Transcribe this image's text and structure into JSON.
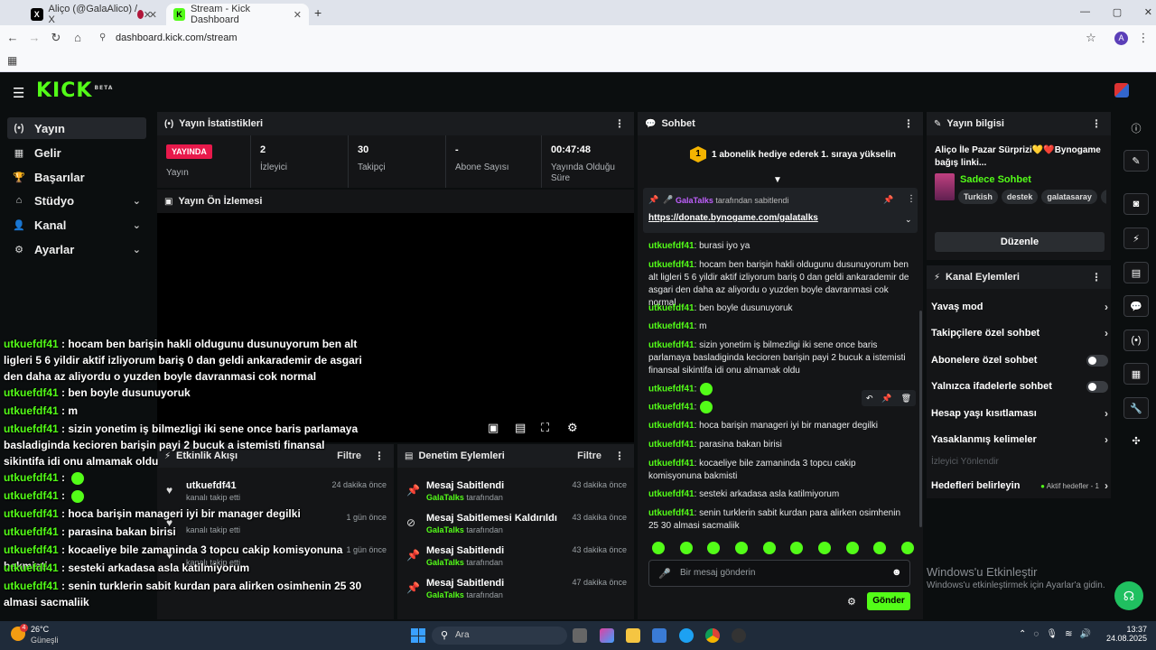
{
  "browser": {
    "tabs": [
      {
        "title": "Aliço (@GalaAlico) / X",
        "icon": "X"
      },
      {
        "title": "",
        "icon": "record"
      },
      {
        "title": "Stream - Kick Dashboard",
        "icon": "K"
      }
    ],
    "new_tab": "+",
    "url": "dashboard.kick.com/stream",
    "profile_initial": "A",
    "window_controls": [
      "—",
      "▢",
      "✕"
    ]
  },
  "kick": {
    "logo": "KICK",
    "logo_badge": "BETA"
  },
  "sidebar": {
    "items": [
      {
        "label": "Yayın",
        "icon": "(•)",
        "chevron": ""
      },
      {
        "label": "Gelir",
        "icon": "▦",
        "chevron": ""
      },
      {
        "label": "Başarılar",
        "icon": "🏆",
        "chevron": ""
      },
      {
        "label": "Stüdyo",
        "icon": "⌂",
        "chevron": "⌄"
      },
      {
        "label": "Kanal",
        "icon": "👤",
        "chevron": "⌄"
      },
      {
        "label": "Ayarlar",
        "icon": "⚙",
        "chevron": "⌄"
      }
    ]
  },
  "stats_panel": {
    "title": "Yayın İstatistikleri",
    "live_badge": "YAYINDA",
    "live_label": "Yayın",
    "viewers_value": "2",
    "viewers_label": "İzleyici",
    "followers_value": "30",
    "followers_label": "Takipçi",
    "subs_value": "-",
    "subs_label": "Abone Sayısı",
    "duration_value": "00:47:48",
    "duration_label": "Yayında Olduğu Süre"
  },
  "preview_panel": {
    "title": "Yayın Ön İzlemesi"
  },
  "overlay_chat": [
    {
      "user": "utkuefdf41",
      "text": " : hocam ben barişin hakli oldugunu dusunuyorum ben alt ligleri 5 6 yildir aktif izliyorum bariş 0 dan geldi ankarademir de asgari den daha az aliyordu o yuzden boyle davranmasi cok normal"
    },
    {
      "user": "utkuefdf41",
      "text": " : ben boyle dusunuyoruk"
    },
    {
      "user": "utkuefdf41",
      "text": " : m"
    },
    {
      "user": "utkuefdf41",
      "text": " : sizin yonetim iş bilmezligi iki sene once baris parlamaya basladiginda kecioren barişin payi 2 bucuk a istemisti finansal sikintifa idi onu almamak oldu"
    },
    {
      "user": "utkuefdf41",
      "text": " : "
    },
    {
      "user": "utkuefdf41",
      "text": " : "
    },
    {
      "user": "utkuefdf41",
      "text": " : hoca barişin manageri iyi bir manager degilki"
    },
    {
      "user": "utkuefdf41",
      "text": " : parasina bakan birisi"
    },
    {
      "user": "utkuefdf41",
      "text": " : kocaeliye bile zamaninda 3 topcu cakip komisyonuna bakmisti"
    },
    {
      "user": "utkuefdf41",
      "text": " : sesteki arkadasa asla katilmiyorum"
    },
    {
      "user": "utkuefdf41",
      "text": " : senin turklerin sabit kurdan para alirken osimhenin 25 30 almasi sacmaliik"
    }
  ],
  "activity_panel": {
    "title": "Etkinlik Akışı",
    "filter": "Filtre",
    "rows": [
      {
        "title": "utkuefdf41",
        "sub": "kanalı takip etti",
        "time": "24 dakika önce"
      },
      {
        "title": "",
        "sub": "kanalı takip etti",
        "time": "1 gün önce"
      },
      {
        "title": "",
        "sub": "kanalı takip etti",
        "time": "1 gün önce"
      }
    ]
  },
  "mod_panel": {
    "title": "Denetim Eylemleri",
    "filter": "Filtre",
    "rows": [
      {
        "title": "Mesaj Sabitlendi",
        "by": "GalaTalks",
        "suffix": " tarafından",
        "time": "43 dakika önce"
      },
      {
        "title": "Mesaj Sabitlemesi Kaldırıldı",
        "by": "GalaTalks",
        "suffix": " tarafından",
        "time": "43 dakika önce"
      },
      {
        "title": "Mesaj Sabitlendi",
        "by": "GalaTalks",
        "suffix": " tarafından",
        "time": "43 dakika önce"
      },
      {
        "title": "Mesaj Sabitlendi",
        "by": "GalaTalks",
        "suffix": " tarafından",
        "time": "47 dakika önce"
      }
    ]
  },
  "chat_panel": {
    "title": "Sohbet",
    "gift_rank": "1",
    "gift_text": "1 abonelik hediye ederek 1. sıraya yükselin",
    "pinned_by": "GalaTalks",
    "pinned_suffix": " tarafından sabitlendi",
    "pinned_link": "https://donate.bynogame.com/galatalks",
    "messages": [
      {
        "user": "utkuefdf41",
        "text": ": burasi iyo ya"
      },
      {
        "user": "utkuefdf41",
        "text": ": hocam ben barişin hakli oldugunu dusunuyorum ben alt ligleri 5 6 yildir aktif izliyorum bariş 0 dan geldi ankarademir de asgari den daha az aliyordu o yuzden boyle davranmasi cok normal"
      },
      {
        "user": "utkuefdf41",
        "text": ": ben boyle dusunuyoruk"
      },
      {
        "user": "utkuefdf41",
        "text": ": m"
      },
      {
        "user": "utkuefdf41",
        "text": ": sizin yonetim iş bilmezligi iki sene once baris parlamaya basladiginda kecioren barişin payi 2 bucuk a istemisti finansal sikintifa idi onu almamak oldu"
      },
      {
        "user": "utkuefdf41",
        "text": ":"
      },
      {
        "user": "utkuefdf41",
        "text": ":"
      },
      {
        "user": "utkuefdf41",
        "text": ": hoca barişin manageri iyi bir manager degilki"
      },
      {
        "user": "utkuefdf41",
        "text": ": parasina bakan birisi"
      },
      {
        "user": "utkuefdf41",
        "text": ": kocaeliye bile zamaninda 3 topcu cakip komisyonuna bakmisti"
      },
      {
        "user": "utkuefdf41",
        "text": ": sesteki arkadasa asla katilmiyorum"
      },
      {
        "user": "utkuefdf41",
        "text": ": senin turklerin sabit kurdan para alirken osimhenin 25 30 almasi sacmaliik"
      }
    ],
    "input_placeholder": "Bir mesaj gönderin",
    "send": "Gönder"
  },
  "info_panel": {
    "title": "Yayın bilgisi",
    "stream_title": "Aliço İle Pazar Sürprizi💛❤️Bynogame bağış linki...",
    "category": "Sadece Sohbet",
    "tags": [
      "Turkish",
      "destek",
      "galatasaray",
      "Ta"
    ],
    "edit": "Düzenle"
  },
  "channel_panel": {
    "title": "Kanal Eylemleri",
    "rows": [
      {
        "label": "Yavaş mod",
        "type": "chevron"
      },
      {
        "label": "Takipçilere özel sohbet",
        "type": "chevron"
      },
      {
        "label": "Abonelere özel sohbet",
        "type": "toggle"
      },
      {
        "label": "Yalnızca ifadelerle sohbet",
        "type": "toggle"
      },
      {
        "label": "Hesap yaşı kısıtlaması",
        "type": "chevron"
      },
      {
        "label": "Yasaklanmış kelimeler",
        "type": "chevron"
      }
    ],
    "viewer_redirect": "İzleyici Yönlendir",
    "goals_label": "Hedefleri belirleyin",
    "goals_status": "Aktif hedefler - 1"
  },
  "windows_activation": {
    "title": "Windows'u Etkinleştir",
    "sub": "Windows'u etkinleştirmek için Ayarlar'a gidin."
  },
  "taskbar": {
    "weather_temp": "26°C",
    "weather_desc": "Güneşli",
    "weather_badge": "4",
    "search": "Ara",
    "time": "13:37",
    "date": "24.08.2025"
  },
  "colors": {
    "accent": "#53fc18",
    "live": "#e8194b",
    "bg": "#0b0e0f",
    "panel": "#141517"
  }
}
